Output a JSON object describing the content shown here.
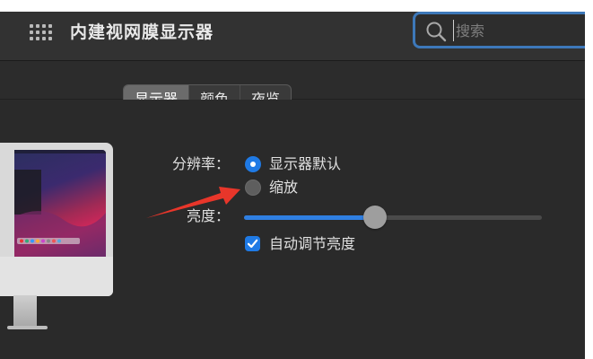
{
  "window": {
    "title": "内建视网膜显示器"
  },
  "search": {
    "placeholder": "搜索",
    "value": ""
  },
  "tabs": [
    {
      "label": "显示器",
      "active": true
    },
    {
      "label": "颜色",
      "active": false
    },
    {
      "label": "夜览",
      "active": false
    }
  ],
  "resolution": {
    "label": "分辨率：",
    "options": [
      {
        "label": "显示器默认",
        "selected": true
      },
      {
        "label": "缩放",
        "selected": false
      }
    ]
  },
  "brightness": {
    "label": "亮度：",
    "level": 0.44
  },
  "auto_brightness": {
    "label": "自动调节亮度",
    "checked": true
  },
  "colors": {
    "accent": "#1f7ae5",
    "annotation_arrow": "#e8362a",
    "window_bg": "#2a2a2a"
  }
}
